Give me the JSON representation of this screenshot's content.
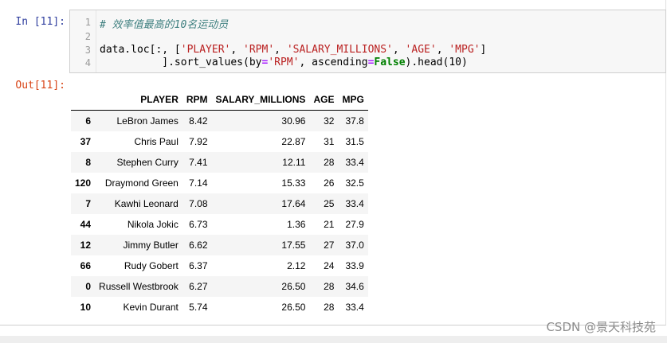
{
  "input_prompt": "In  [11]:",
  "output_prompt": "Out[11]:",
  "code": {
    "line_numbers": [
      "1",
      "2",
      "3",
      "4"
    ],
    "comment": "# 效率值最高的10名运动员",
    "line3_a": "data.loc[:, [",
    "line3_s1": "'PLAYER'",
    "line3_sep1": ", ",
    "line3_s2": "'RPM'",
    "line3_sep2": ", ",
    "line3_s3": "'SALARY_MILLIONS'",
    "line3_sep3": ", ",
    "line3_s4": "'AGE'",
    "line3_sep4": ", ",
    "line3_s5": "'MPG'",
    "line3_b": "]",
    "line4_a": "          ].sort_values(by",
    "line4_eq1": "=",
    "line4_s1": "'RPM'",
    "line4_b": ", ascending",
    "line4_eq2": "=",
    "line4_kw": "False",
    "line4_c": ").head(10)"
  },
  "table": {
    "columns": [
      "",
      "PLAYER",
      "RPM",
      "SALARY_MILLIONS",
      "AGE",
      "MPG"
    ],
    "rows": [
      {
        "index": "6",
        "player": "LeBron James",
        "rpm": "8.42",
        "salary": "30.96",
        "age": "32",
        "mpg": "37.8"
      },
      {
        "index": "37",
        "player": "Chris Paul",
        "rpm": "7.92",
        "salary": "22.87",
        "age": "31",
        "mpg": "31.5"
      },
      {
        "index": "8",
        "player": "Stephen Curry",
        "rpm": "7.41",
        "salary": "12.11",
        "age": "28",
        "mpg": "33.4"
      },
      {
        "index": "120",
        "player": "Draymond Green",
        "rpm": "7.14",
        "salary": "15.33",
        "age": "26",
        "mpg": "32.5"
      },
      {
        "index": "7",
        "player": "Kawhi Leonard",
        "rpm": "7.08",
        "salary": "17.64",
        "age": "25",
        "mpg": "33.4"
      },
      {
        "index": "44",
        "player": "Nikola Jokic",
        "rpm": "6.73",
        "salary": "1.36",
        "age": "21",
        "mpg": "27.9"
      },
      {
        "index": "12",
        "player": "Jimmy Butler",
        "rpm": "6.62",
        "salary": "17.55",
        "age": "27",
        "mpg": "37.0"
      },
      {
        "index": "66",
        "player": "Rudy Gobert",
        "rpm": "6.37",
        "salary": "2.12",
        "age": "24",
        "mpg": "33.9"
      },
      {
        "index": "0",
        "player": "Russell Westbrook",
        "rpm": "6.27",
        "salary": "26.50",
        "age": "28",
        "mpg": "34.6"
      },
      {
        "index": "10",
        "player": "Kevin Durant",
        "rpm": "5.74",
        "salary": "26.50",
        "age": "28",
        "mpg": "33.4"
      }
    ]
  },
  "watermark": "CSDN @景天科技苑"
}
